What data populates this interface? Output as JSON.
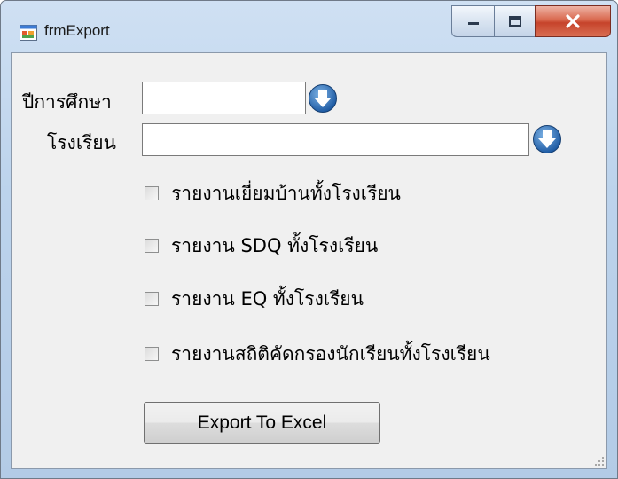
{
  "window": {
    "title": "frmExport"
  },
  "form": {
    "year_label": "ปีการศึกษา",
    "year_value": "",
    "school_label": "โรงเรียน",
    "school_value": ""
  },
  "checkboxes": [
    {
      "label": "รายงานเยี่ยมบ้านทั้งโรงเรียน",
      "checked": false
    },
    {
      "label": "รายงาน SDQ ทั้งโรงเรียน",
      "checked": false
    },
    {
      "label": "รายงาน EQ ทั้งโรงเรียน",
      "checked": false
    },
    {
      "label": "รายงานสถิติคัดกรองนักเรียนทั้งโรงเรียน",
      "checked": false
    }
  ],
  "actions": {
    "export_label": "Export To Excel"
  },
  "colors": {
    "accent": "#3a6fb0",
    "client_bg": "#f0f0f0"
  },
  "icons": {
    "app": "form-app-icon",
    "dropdown": "download-arrow-icon",
    "minimize": "minimize-icon",
    "maximize": "maximize-icon",
    "close": "close-icon"
  }
}
